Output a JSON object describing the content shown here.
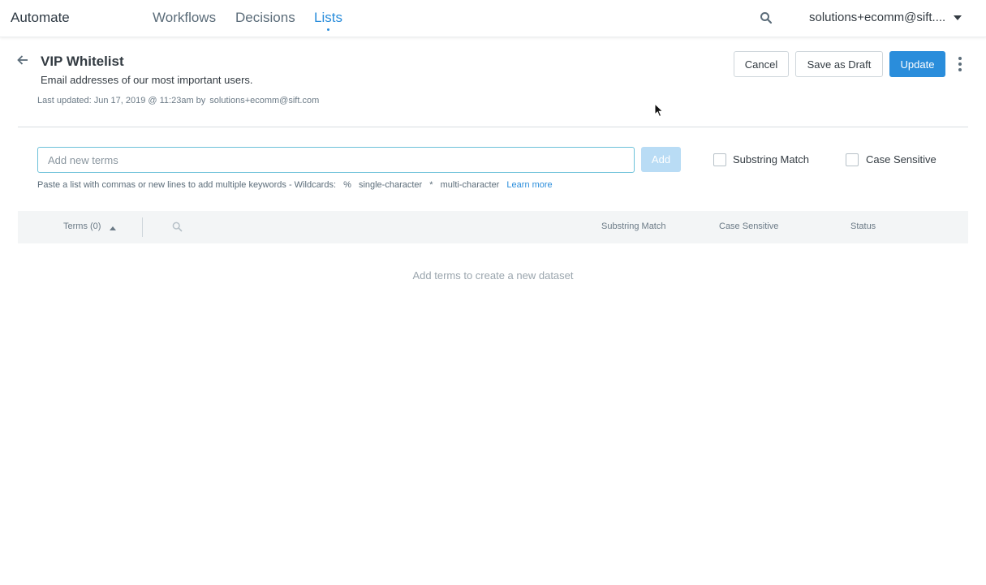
{
  "app": {
    "brand": "Automate"
  },
  "nav": {
    "tabs": [
      {
        "label": "Workflows",
        "active": false
      },
      {
        "label": "Decisions",
        "active": false
      },
      {
        "label": "Lists",
        "active": true
      }
    ],
    "account": "solutions+ecomm@sift...."
  },
  "header": {
    "title": "VIP Whitelist",
    "description": "Email addresses of our most important users.",
    "last_updated_label": "Last updated: Jun 17, 2019 @ 11:23am by",
    "last_updated_user": "solutions+ecomm@sift.com"
  },
  "actions": {
    "cancel": "Cancel",
    "save_draft": "Save as Draft",
    "update": "Update"
  },
  "add_terms": {
    "placeholder": "Add new terms",
    "add_label": "Add",
    "substring_match_label": "Substring Match",
    "case_sensitive_label": "Case Sensitive",
    "substring_match_checked": false,
    "case_sensitive_checked": false,
    "hint_text": "Paste a list with commas or new lines to add multiple keywords - Wildcards:",
    "wildcard_single_symbol": "%",
    "wildcard_single_label": "single-character",
    "wildcard_multi_symbol": "*",
    "wildcard_multi_label": "multi-character",
    "learn_more": "Learn more"
  },
  "table": {
    "columns": {
      "terms": "Terms (0)",
      "substring_match": "Substring Match",
      "case_sensitive": "Case Sensitive",
      "status": "Status"
    },
    "rows": [],
    "empty_message": "Add terms to create a new dataset"
  },
  "colors": {
    "accent": "#2a8ddb",
    "add_disabled": "#b9dcf5",
    "input_border": "#6cc1d9"
  }
}
